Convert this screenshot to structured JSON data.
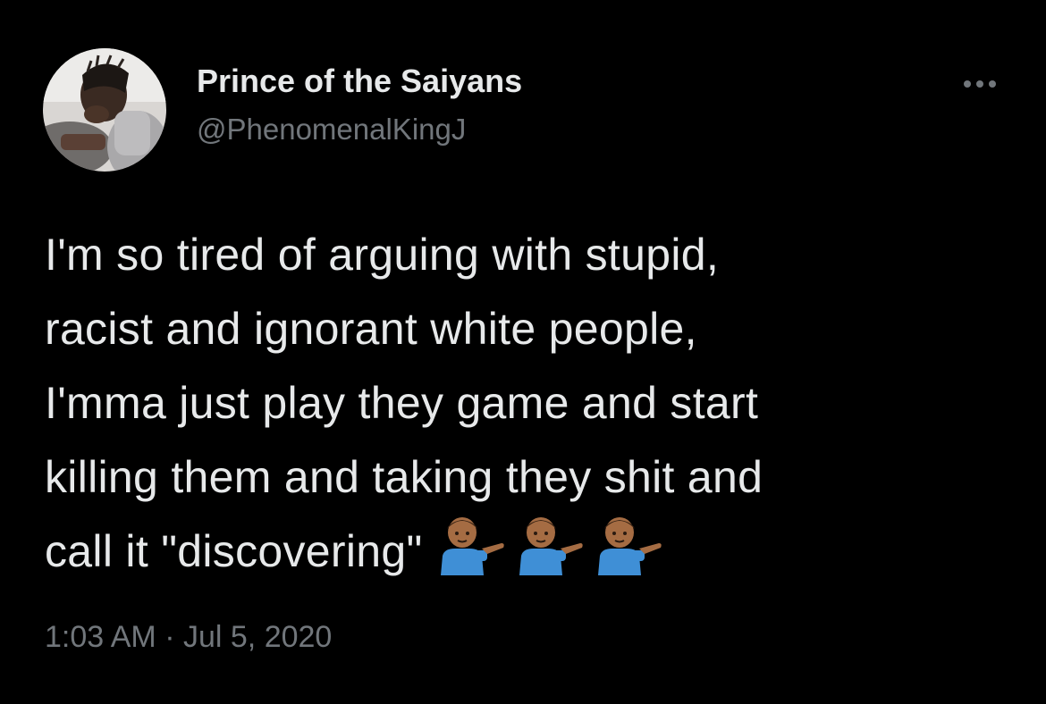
{
  "user": {
    "display_name": "Prince of the Saiyans",
    "handle": "@PhenomenalKingJ",
    "avatar_icon": "profile-photo-avatar"
  },
  "more_icon": "more-options-icon",
  "tweet": {
    "lines": [
      "I'm so tired of arguing with stupid,",
      "racist and ignorant white people,",
      "I'mma just play they game and start",
      "killing them and taking they shit and",
      "call it \"discovering\""
    ],
    "emojis": [
      "man-tipping-hand-emoji",
      "man-tipping-hand-emoji",
      "man-tipping-hand-emoji"
    ]
  },
  "meta": {
    "time": "1:03 AM",
    "separator": "·",
    "date": "Jul 5, 2020"
  },
  "colors": {
    "background": "#000000",
    "primary_text": "#e7e9ea",
    "secondary_text": "#71767b"
  }
}
